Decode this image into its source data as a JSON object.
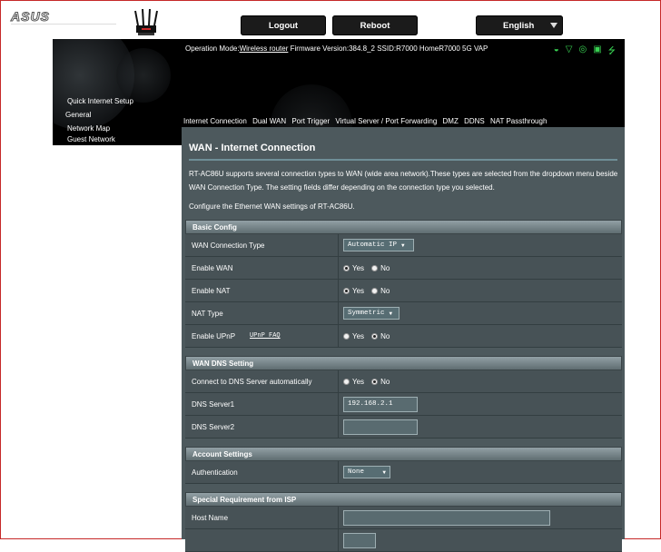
{
  "brand": {
    "logo_text": "ASUS"
  },
  "header": {
    "logout_label": "Logout",
    "reboot_label": "Reboot",
    "language_label": "English"
  },
  "banner": {
    "op_mode_prefix": "Operation Mode:",
    "op_mode_value": "Wireless router",
    "firmware_text": " Firmware Version:384.8_2 SSID:R7000 HomeR7000 5G VAP",
    "status_icons": [
      "usb-status-icon",
      "wifi-status-icon",
      "user-status-icon",
      "app-status-icon",
      "usb-plug-icon"
    ],
    "status_color": "#39d353"
  },
  "sidebar": {
    "items": [
      {
        "label": "Quick Internet Setup"
      },
      {
        "label": "General"
      },
      {
        "label": "Network Map"
      },
      {
        "label": "Guest Network"
      }
    ]
  },
  "tabs": [
    {
      "label": "Internet Connection"
    },
    {
      "label": "Dual WAN"
    },
    {
      "label": "Port Trigger"
    },
    {
      "label": "Virtual Server / Port Forwarding"
    },
    {
      "label": "DMZ"
    },
    {
      "label": "DDNS"
    },
    {
      "label": "NAT Passthrough"
    }
  ],
  "main": {
    "title": "WAN - Internet Connection",
    "description": "RT-AC86U supports several connection types to WAN (wide area network).These types are selected from the dropdown menu beside WAN Connection Type. The setting fields differ depending on the connection type you selected.",
    "configure_text": "Configure the Ethernet WAN settings of RT-AC86U."
  },
  "basic_config": {
    "header": "Basic Config",
    "wan_type_label": "WAN Connection Type",
    "wan_type_value": "Automatic IP",
    "enable_wan_label": "Enable WAN",
    "enable_nat_label": "Enable NAT",
    "nat_type_label": "NAT Type",
    "nat_type_value": "Symmetric",
    "enable_upnp_label": "Enable UPnP",
    "upnp_faq_link": "UPnP FAQ",
    "yes_label": "Yes",
    "no_label": "No",
    "enable_wan_value": "Yes",
    "enable_nat_value": "Yes",
    "enable_upnp_value": "No"
  },
  "dns": {
    "header": "WAN DNS Setting",
    "auto_label": "Connect to DNS Server automatically",
    "auto_value": "No",
    "server1_label": "DNS Server1",
    "server1_value": "192.168.2.1",
    "server2_label": "DNS Server2",
    "server2_value": ""
  },
  "account": {
    "header": "Account Settings",
    "auth_label": "Authentication",
    "auth_value": "None"
  },
  "isp": {
    "header": "Special Requirement from ISP",
    "host_name_label": "Host Name",
    "host_name_value": ""
  },
  "colors": {
    "panel_bg": "#4d595d",
    "row_bg": "#475256",
    "banner_bg": "#000000",
    "accent_green": "#39d353"
  }
}
